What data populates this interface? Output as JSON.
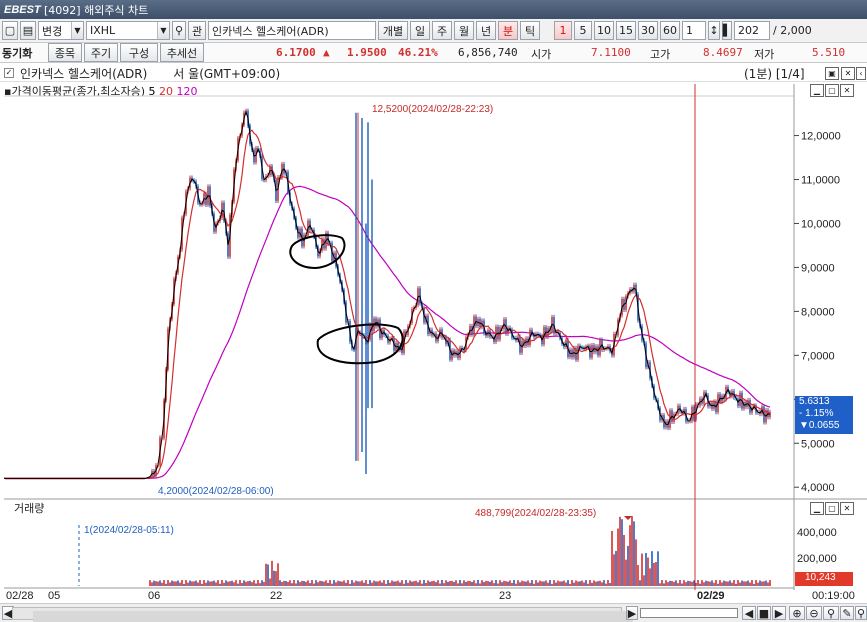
{
  "titlebar": {
    "logo": "EBEST",
    "title": "[4092] 해외주식 차트"
  },
  "toolbar": {
    "change_label": "변경",
    "symbol": "IXHL",
    "search_icon": "search-icon",
    "link_label": "관",
    "name": "인카넥스 헬스케어(ADR)",
    "individual": "개별",
    "periods": [
      "일",
      "주",
      "월",
      "년",
      "분",
      "틱"
    ],
    "active_period": "분",
    "intervals": [
      "1",
      "5",
      "10",
      "15",
      "30",
      "60"
    ],
    "active_interval": "1",
    "count_value": "1",
    "bars_value": "202",
    "bars_total": "/ 2,000"
  },
  "quote": {
    "sync_label": "동기화",
    "tabs": [
      "종목",
      "주기",
      "구성",
      "추세선"
    ],
    "price": "6.1700",
    "arrow": "▲",
    "change": "1.9500",
    "change_pct": "46.21%",
    "volume": "6,856,740",
    "open_label": "시가",
    "open": "7.1100",
    "high_label": "고가",
    "high": "8.4697",
    "low_label": "저가",
    "low": "5.510"
  },
  "chart_header": {
    "title": "인카넥스 헬스케어(ADR)",
    "timezone": "서    울(GMT+09:00)",
    "page_info": "(1분) [1/4]",
    "ma_label": "가격이동평균(종가,최소자승)",
    "ma_periods": [
      "5",
      "20",
      "120"
    ]
  },
  "colors": {
    "up": "#d32f2f",
    "down": "#1e5fbf",
    "ma5": "#000000",
    "ma20": "#d32f2f",
    "ma120": "#c000c0"
  },
  "annotations": {
    "high": "12,5200(2024/02/28-22:23)",
    "low": "4,2000(2024/02/28-06:00)",
    "vol_high": "488,799(2024/02/28-23:35)",
    "vol_low": "1(2024/02/28-05:11)"
  },
  "price_tag": {
    "price": "5.6313",
    "pct": "- 1.15%",
    "diff": "▼0.0655"
  },
  "volume_panel": {
    "label": "거래량",
    "tag": "10,243",
    "ticks": [
      "400,000",
      "200,000"
    ]
  },
  "x_labels": [
    "02/28",
    "05",
    "06",
    "22",
    "23",
    "02/29",
    "00:19:00"
  ],
  "chart_data": {
    "type": "candlestick",
    "y_ticks": [
      "12,0000",
      "11,0000",
      "10,0000",
      "9,0000",
      "8,0000",
      "7,0000",
      "6,0000",
      "5,0000",
      "4,0000"
    ],
    "ylim": [
      3.8,
      12.9
    ],
    "close_path": [
      [
        0,
        4.2
      ],
      [
        145,
        4.2
      ],
      [
        155,
        4.3
      ],
      [
        162,
        5.2
      ],
      [
        168,
        7.5
      ],
      [
        175,
        8.8
      ],
      [
        180,
        9.5
      ],
      [
        185,
        10.6
      ],
      [
        192,
        11.1
      ],
      [
        200,
        10.4
      ],
      [
        208,
        10.7
      ],
      [
        215,
        9.8
      ],
      [
        222,
        10.4
      ],
      [
        228,
        9.4
      ],
      [
        234,
        11.2
      ],
      [
        240,
        12.1
      ],
      [
        246,
        12.6
      ],
      [
        252,
        11.5
      ],
      [
        258,
        11.7
      ],
      [
        264,
        10.9
      ],
      [
        270,
        11.3
      ],
      [
        276,
        10.7
      ],
      [
        283,
        11.4
      ],
      [
        290,
        10.5
      ],
      [
        296,
        9.9
      ],
      [
        302,
        9.6
      ],
      [
        310,
        10.0
      ],
      [
        318,
        9.3
      ],
      [
        326,
        9.7
      ],
      [
        334,
        9.2
      ],
      [
        340,
        8.7
      ],
      [
        346,
        7.9
      ],
      [
        352,
        7.1
      ],
      [
        358,
        7.6
      ],
      [
        366,
        7.3
      ],
      [
        374,
        7.8
      ],
      [
        382,
        7.5
      ],
      [
        392,
        7.3
      ],
      [
        400,
        7.1
      ],
      [
        410,
        7.8
      ],
      [
        418,
        8.4
      ],
      [
        426,
        7.7
      ],
      [
        434,
        7.4
      ],
      [
        442,
        7.5
      ],
      [
        452,
        7.0
      ],
      [
        462,
        7.1
      ],
      [
        470,
        7.6
      ],
      [
        478,
        7.8
      ],
      [
        486,
        7.5
      ],
      [
        494,
        7.4
      ],
      [
        504,
        7.7
      ],
      [
        514,
        7.4
      ],
      [
        522,
        7.2
      ],
      [
        532,
        7.5
      ],
      [
        542,
        7.4
      ],
      [
        552,
        7.7
      ],
      [
        562,
        7.3
      ],
      [
        572,
        7.0
      ],
      [
        582,
        7.2
      ],
      [
        592,
        7.1
      ],
      [
        602,
        7.2
      ],
      [
        612,
        7.1
      ],
      [
        620,
        8.0
      ],
      [
        628,
        8.4
      ],
      [
        634,
        8.6
      ],
      [
        640,
        7.6
      ],
      [
        648,
        6.7
      ],
      [
        656,
        5.9
      ],
      [
        664,
        5.4
      ],
      [
        672,
        5.6
      ],
      [
        680,
        5.8
      ],
      [
        688,
        5.5
      ],
      [
        696,
        5.8
      ],
      [
        704,
        6.1
      ],
      [
        712,
        5.8
      ],
      [
        720,
        6.0
      ],
      [
        728,
        6.2
      ],
      [
        736,
        6.0
      ],
      [
        744,
        5.9
      ],
      [
        752,
        5.8
      ],
      [
        760,
        5.7
      ],
      [
        768,
        5.63
      ]
    ],
    "high": 12.52,
    "low": 4.2
  }
}
